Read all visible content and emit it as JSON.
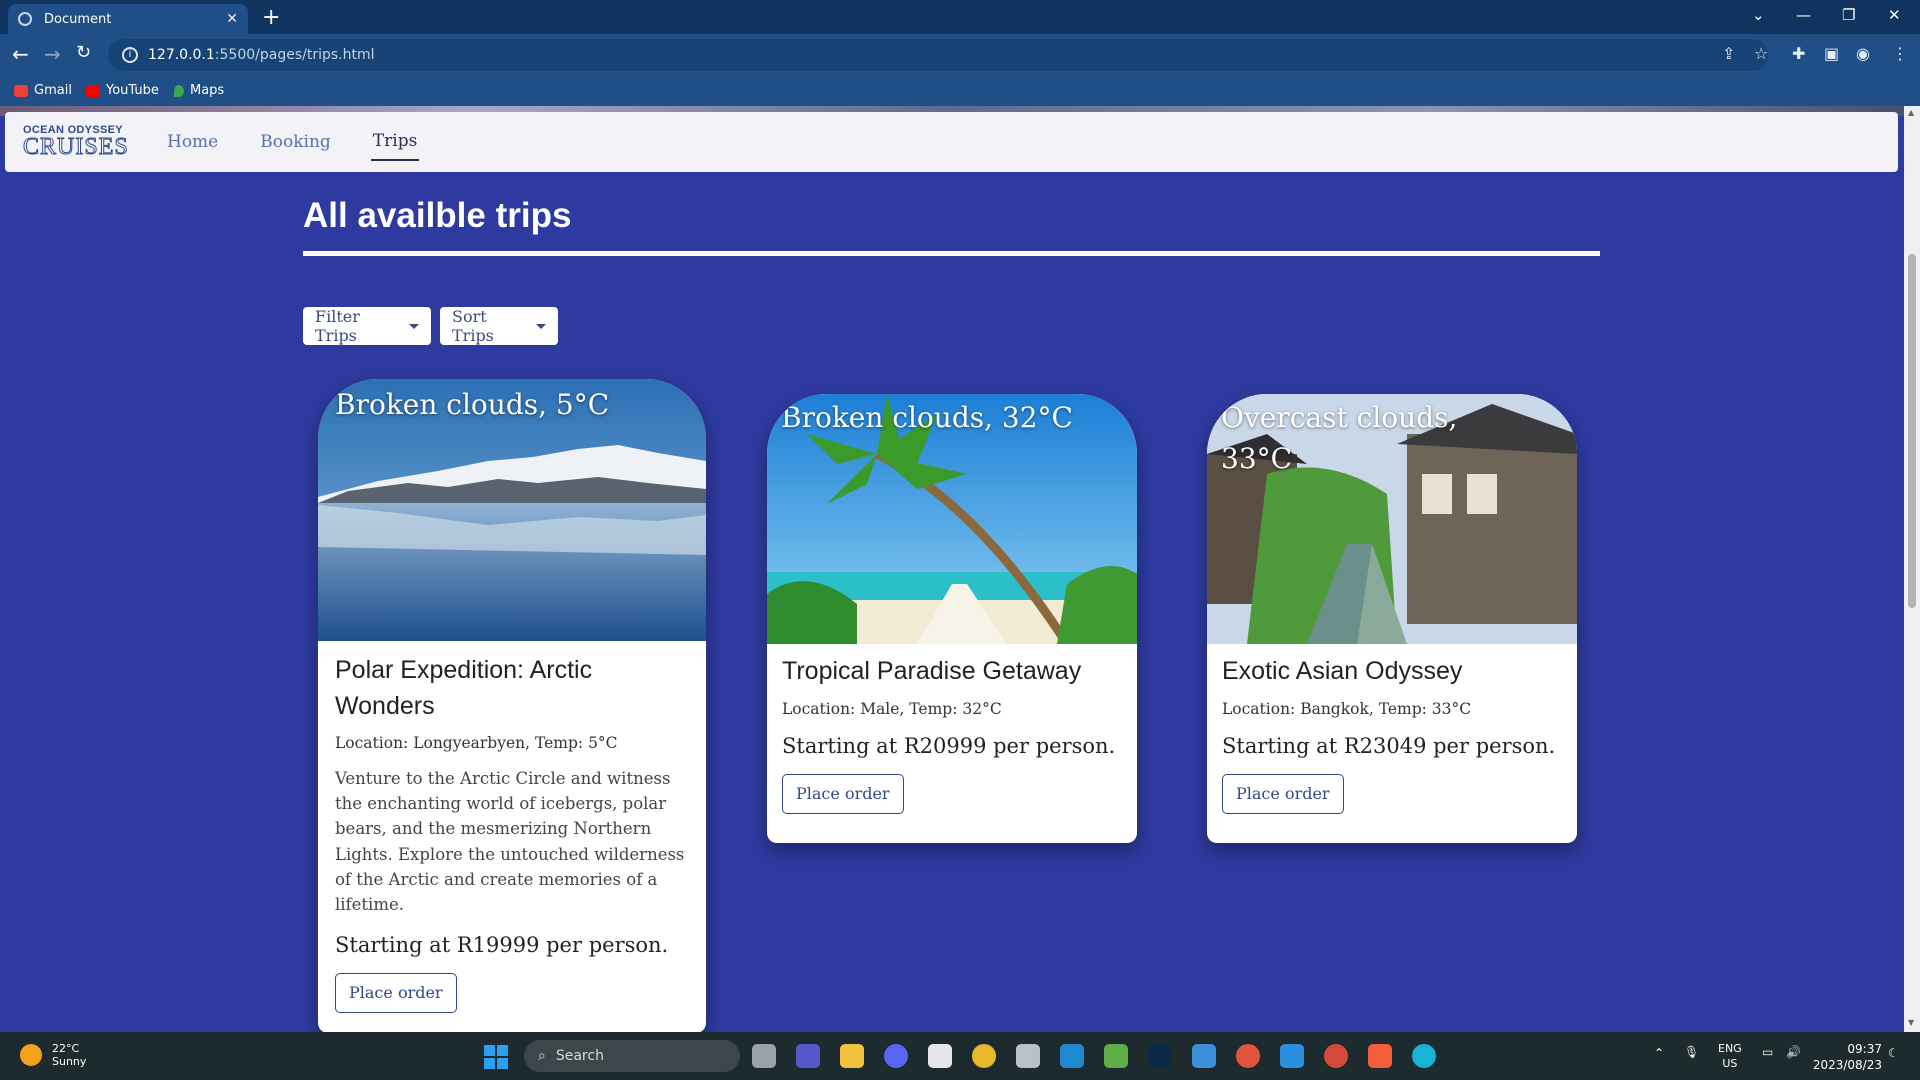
{
  "browser": {
    "tab_title": "Document",
    "url_host": "127.0.0.1",
    "url_path": ":5500/pages/trips.html",
    "bookmarks": [
      {
        "label": "Gmail",
        "color": "#ea4335"
      },
      {
        "label": "YouTube",
        "color": "#ff0000"
      },
      {
        "label": "Maps",
        "color": "#34a853"
      }
    ]
  },
  "site": {
    "logo_top": "OCEAN ODYSSEY",
    "logo_bottom": "CRUISES",
    "nav": [
      "Home",
      "Booking",
      "Trips"
    ],
    "active_nav": "Trips",
    "page_title": "All availble trips",
    "filter_label": "Filter Trips",
    "sort_label": "Sort Trips",
    "background_color": "#2e3a9f"
  },
  "trips": [
    {
      "weather": "Broken clouds, 5°C",
      "name": "Polar Expedition: Arctic Wonders",
      "location": "Location: Longyearbyen, Temp: 5°C",
      "description": "Venture to the Arctic Circle and witness the enchanting world of icebergs, polar bears, and the mesmerizing Northern Lights. Explore the untouched wilderness of the Arctic and create memories of a lifetime.",
      "price": "Starting at R19999 per person.",
      "button": "Place order"
    },
    {
      "weather": "Broken clouds, 32°C",
      "name": "Tropical Paradise Getaway",
      "location": "Location: Male, Temp: 32°C",
      "description": "",
      "price": "Starting at R20999 per person.",
      "button": "Place order"
    },
    {
      "weather": "Overcast clouds, 33°C",
      "name": "Exotic Asian Odyssey",
      "location": "Location: Bangkok, Temp: 33°C",
      "description": "",
      "price": "Starting at R23049 per person.",
      "button": "Place order"
    }
  ],
  "taskbar": {
    "weather_temp": "22°C",
    "weather_desc": "Sunny",
    "search_label": "Search",
    "lang_top": "ENG",
    "lang_bottom": "US",
    "time": "09:37",
    "date": "2023/08/23"
  }
}
